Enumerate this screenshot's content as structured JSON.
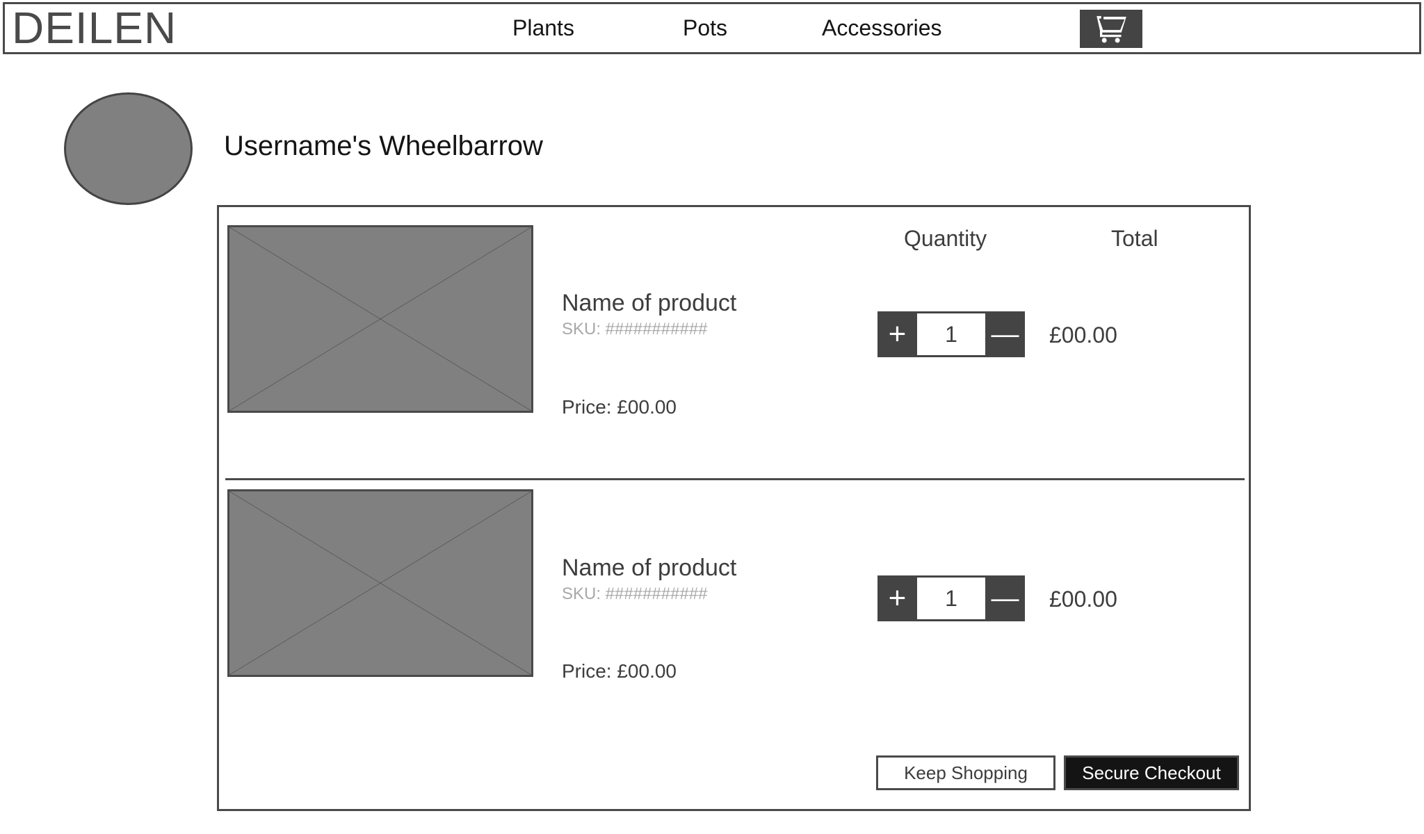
{
  "header": {
    "logo": "DEILEN",
    "nav": [
      {
        "label": "Plants"
      },
      {
        "label": "Pots"
      },
      {
        "label": "Accessories"
      }
    ],
    "cart_icon": "shopping-cart-icon"
  },
  "account": {
    "avatar_icon": "user-avatar-placeholder",
    "page_title": "Username's Wheelbarrow"
  },
  "cart": {
    "columns": {
      "quantity": "Quantity",
      "total": "Total"
    },
    "items": [
      {
        "image_placeholder": "product-image-placeholder",
        "name": "Name of product",
        "sku": "SKU: ###########",
        "price": "Price: £00.00",
        "quantity": "1",
        "increment_label": "+",
        "decrement_label": "—",
        "total": "£00.00"
      },
      {
        "image_placeholder": "product-image-placeholder",
        "name": "Name of product",
        "sku": "SKU: ###########",
        "price": "Price: £00.00",
        "quantity": "1",
        "increment_label": "+",
        "decrement_label": "—",
        "total": "£00.00"
      }
    ],
    "actions": {
      "keep_shopping": "Keep Shopping",
      "secure_checkout": "Secure Checkout"
    }
  },
  "colors": {
    "border": "#4a4a4a",
    "dark_control": "#444444",
    "checkout_dark": "#141414",
    "placeholder_gray": "#808080",
    "muted_text": "#a8a8a8",
    "body_text": "#3d3d3d",
    "page_background": "#ffffff"
  }
}
